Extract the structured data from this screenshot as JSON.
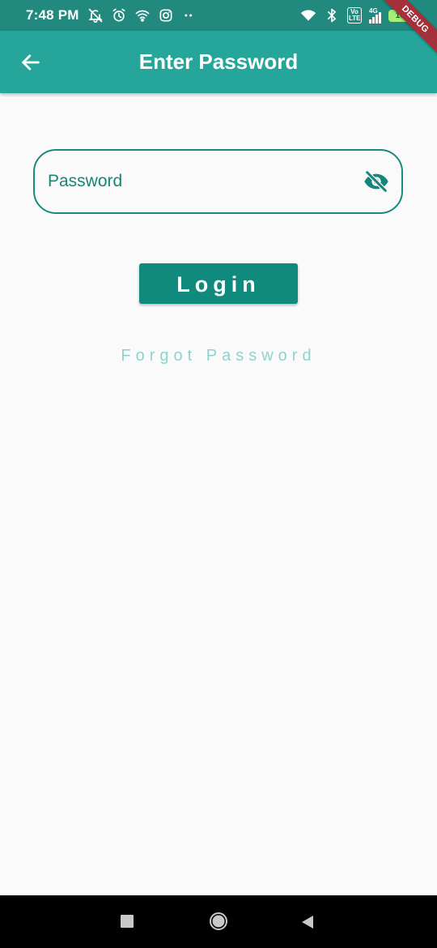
{
  "status_bar": {
    "time": "7:48 PM",
    "left_icons": [
      "silent-bell-icon",
      "alarm-icon",
      "wifi-hotspot-icon",
      "instagram-icon",
      "more-dots-icon"
    ],
    "right_icons": [
      "wifi-icon",
      "bluetooth-icon",
      "volte-icon",
      "signal-4g-icon",
      "battery-icon"
    ],
    "volte_label": "Vo LTE",
    "network_label": "4G",
    "battery_level": "100",
    "debug_banner": "DEBUG"
  },
  "app_bar": {
    "title": "Enter Password",
    "back_icon": "arrow-back-icon"
  },
  "form": {
    "password_label": "Password",
    "visibility_icon": "visibility-off-icon",
    "login_label": "Login",
    "forgot_label": "Forgot Password"
  },
  "colors": {
    "status_bar": "#21897d",
    "app_bar": "#26a69a",
    "accent": "#108a7c",
    "forgot_link": "#8fd3cf",
    "background": "#fafafa"
  }
}
